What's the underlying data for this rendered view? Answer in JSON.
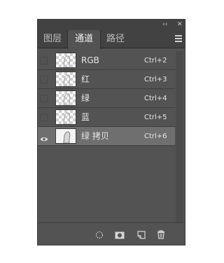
{
  "panel": {
    "titlebar": {
      "collapse_glyph": "‹‹",
      "close_glyph": "✕"
    },
    "tabs": [
      {
        "label": "图层",
        "active": false
      },
      {
        "label": "通道",
        "active": true
      },
      {
        "label": "路径",
        "active": false
      }
    ],
    "channels": [
      {
        "name": "RGB",
        "shortcut": "Ctrl+2",
        "visible": false,
        "selected": false
      },
      {
        "name": "红",
        "shortcut": "Ctrl+3",
        "visible": false,
        "selected": false
      },
      {
        "name": "绿",
        "shortcut": "Ctrl+4",
        "visible": false,
        "selected": false
      },
      {
        "name": "蓝",
        "shortcut": "Ctrl+5",
        "visible": false,
        "selected": false
      },
      {
        "name": "绿 拷贝",
        "shortcut": "Ctrl+6",
        "visible": true,
        "selected": true
      }
    ],
    "footer_icons": [
      "load-selection-icon",
      "save-selection-icon",
      "new-channel-icon",
      "delete-icon"
    ],
    "colors": {
      "panel_bg": "#535353",
      "selected_row": "#6f6f6f",
      "tab_bar": "#424242"
    }
  }
}
